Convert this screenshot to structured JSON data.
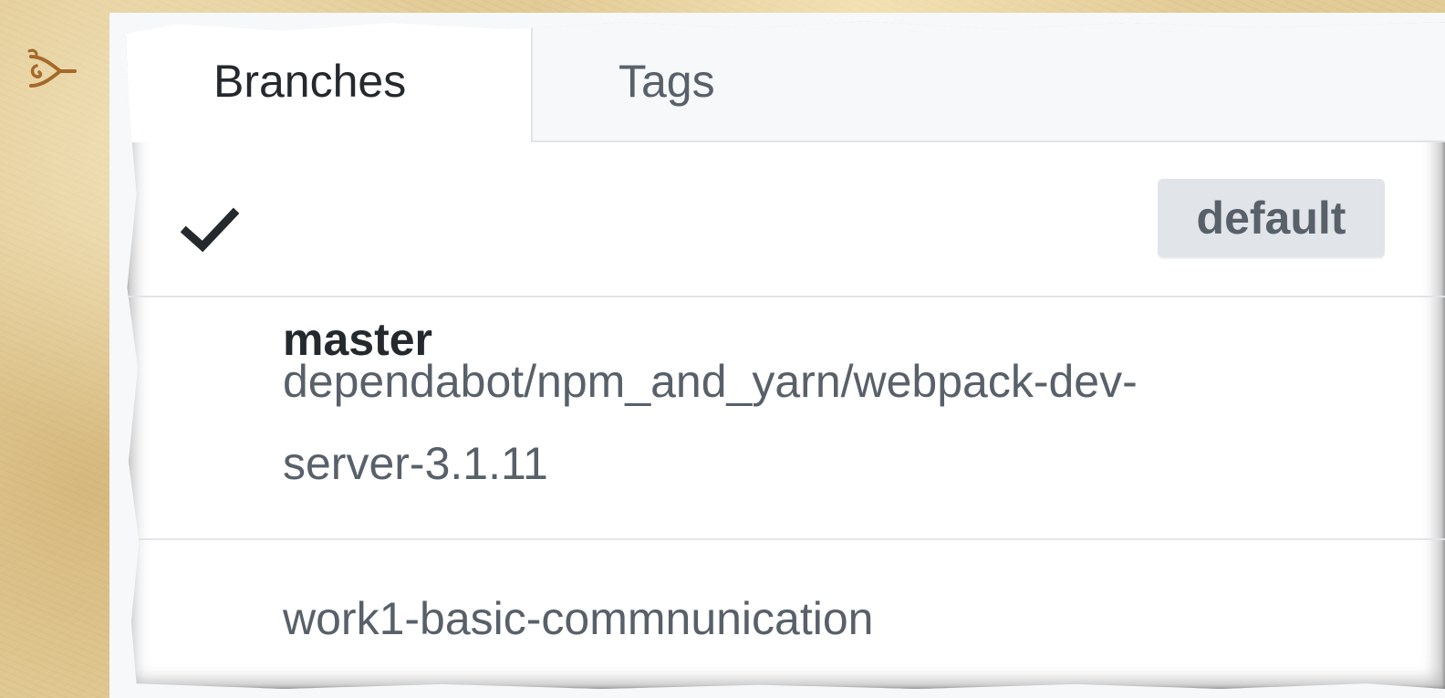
{
  "tabs": [
    {
      "label": "Branches",
      "active": true
    },
    {
      "label": "Tags",
      "active": false
    }
  ],
  "branches": [
    {
      "name": "master",
      "selected": true,
      "badge": "default"
    },
    {
      "name_line1": "dependabot/npm_and_yarn/webpack-dev-",
      "name_line2": "server-3.1.11",
      "selected": false
    },
    {
      "name": "work1-basic-commnunication",
      "selected": false
    }
  ],
  "icons": {
    "selected_marker": "check-icon",
    "page_ornament": "scroll-ornament-icon"
  },
  "colors": {
    "text_primary": "#24292e",
    "text_secondary": "#586069",
    "tab_bar_bg": "#f6f8fa",
    "border": "#e1e4e8",
    "badge_bg": "#e1e4e8",
    "background": "#e2cb96",
    "ornament": "#a5692a"
  }
}
